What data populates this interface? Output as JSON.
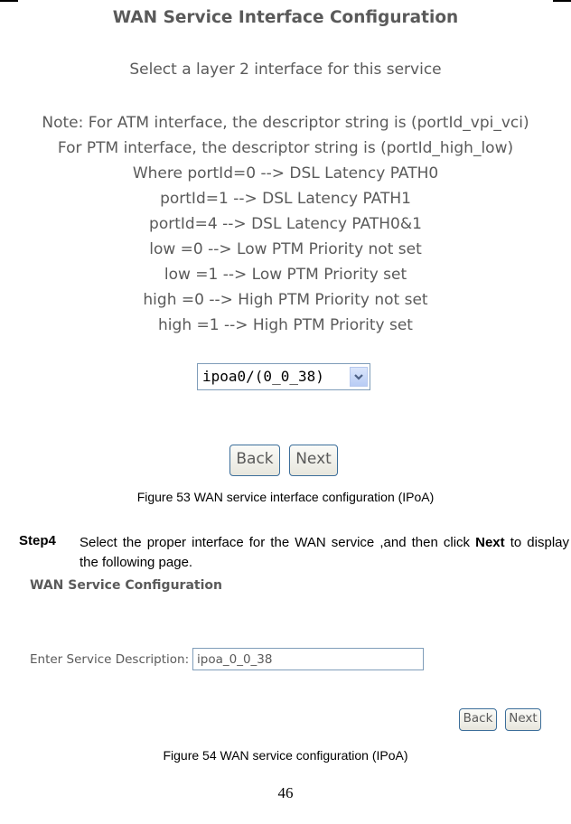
{
  "figure53": {
    "title": "WAN Service Interface Configuration",
    "subtitle": "Select a layer 2 interface for this service",
    "notes": [
      "Note: For ATM interface, the descriptor string is (portId_vpi_vci)",
      "For PTM interface, the descriptor string is (portId_high_low)",
      "Where portId=0 --> DSL Latency PATH0",
      "portId=1 --> DSL Latency PATH1",
      "portId=4 --> DSL Latency PATH0&1",
      "low =0 --> Low PTM Priority not set",
      "low =1 --> Low PTM Priority set",
      "high =0 --> High PTM Priority not set",
      "high =1 --> High PTM Priority set"
    ],
    "interface_select": {
      "selected": "ipoa0/(0_0_38)",
      "icon": "chevron-down-icon"
    },
    "back_label": "Back",
    "next_label": "Next",
    "caption": "Figure 53 WAN service interface configuration (IPoA)"
  },
  "step": {
    "label": "Step4",
    "text_before": "Select the proper interface for the WAN service ,and then click ",
    "text_bold": "Next",
    "text_after": " to display the following page."
  },
  "figure54": {
    "title": "WAN Service Configuration",
    "description_label": "Enter Service Description:",
    "description_value": "ipoa_0_0_38",
    "back_label": "Back",
    "next_label": "Next",
    "caption": "Figure 54 WAN service configuration (IPoA)"
  },
  "page_number": "46"
}
